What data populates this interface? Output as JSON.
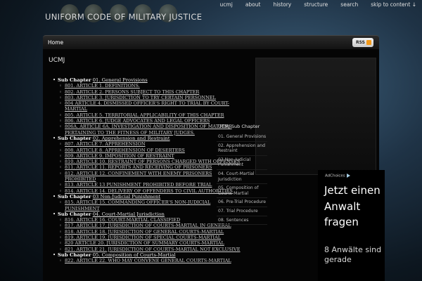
{
  "site_title": "UNIFORM CODE OF MILITARY JUSTICE",
  "top_nav": [
    "ucmj",
    "about",
    "history",
    "structure",
    "search",
    "skip to content ↓"
  ],
  "navbar": {
    "home": "Home",
    "rss": "RSS"
  },
  "page_title": "UCMJ",
  "chapter_prefix": "Sub Chapter",
  "chapters": [
    {
      "link": "01. General Provisions",
      "articles": [
        "801. ARTICLE 1. DEFINITIONS.",
        "802. ARTICLE 2. PERSONS SUBJECT TO THIS CHAPTER",
        "803. ARTICLE 3. JURISDICTION TO TRY CERTAIN PERSONNEL",
        "804 ARTICLE 4. DISMISSED OFFICER'S RIGHT TO TRIAL BY COURT-MARTIAL",
        "805. ARTICLE 5. TERRITORIAL APPLICABILITY OF THIS CHAPTER",
        "806. ARTICLE 6. JUDGE ADVOCATES AND LEGAL OFFICERS",
        "806a. ARTICLE 6a. INVESTIGATION AND DISPOSITION OF MATTERS PERTAINING TO THE FITNESS OF MILITARY JUDGES."
      ]
    },
    {
      "link": "02. Apprehension and Restraint",
      "articles": [
        "807. ARTICLE 7. APPREHENSION",
        "808. ARTICLE 8. APPREHENSION OF DESERTERS",
        "809. ARTICLE 9. IMPOSITION OF RESTRAINT",
        "810. ARTICLE 10. RESTRAINT OF PERSONS CHARGED WITH OFFENSES",
        "811. ARTICLE 11. REPORTS AND RECEIVING OF PRISONERS",
        "812. ARTICLE 12. CONFINEMENT WITH ENEMY PRISONERS PROHIBITED",
        "813. ARTICLE 13 PUNISHMENT PROHIBITED BEFORE TRIAL",
        "814. ARTICLE 14. DELIVERY OF OFFENDERS TO CIVIL AUTHORITIES"
      ]
    },
    {
      "link": "03 Non-Judicial Punishment",
      "articles": [
        "815. ARTICLE 15. COMMANDING OFFICER'S NON-JUDICIAL PUNISHMENT"
      ]
    },
    {
      "link": "04. Court-Martial Jurisdiction",
      "articles": [
        "816. ARTICLE 16. COURT-MARTIAL CLASSIFIED",
        "817. ARTICLE 17. JURISDICTION OF COURTS-MARTIAL IN GENERAL",
        "818. ARTICLE 18. JURISDICTION OF GENERAL COURTS-MARTIAL",
        "819. ARTICLE 19. JURISDICTION OF SPECIAL COURTS-MARTIAL",
        "820 ARTICLE 20. JURISDICTION OF SUMMARY COURTS-MARTIAL",
        "821. ARTICLE 21. JURISDICTION OF COURTS-MARTIAL NOT EXCLUSIVE"
      ]
    },
    {
      "link": "05. Composition of Courts-Martial",
      "articles": [
        "822. ARTICLE 22. WHO MAY CONVENE GENERAL COURTS-MARTIAL"
      ]
    }
  ],
  "sidebar_widget": {
    "title": "UCMJ Sub Chapter",
    "items": [
      "01. General Provisions",
      "02. Apprehension and Restraint",
      "03 Non-Judicial Punishment",
      "04. Court-Martial Jurisdiction",
      "05. Composition of Courts-Martial",
      "06. Pre-Trial Procedure",
      "07. Trial Procedure",
      "08. Sentences"
    ]
  },
  "ad": {
    "choices": "AdChoices",
    "headline": "Jetzt einen Anwalt fragen",
    "sub": "8 Anwälte sind gerade"
  }
}
